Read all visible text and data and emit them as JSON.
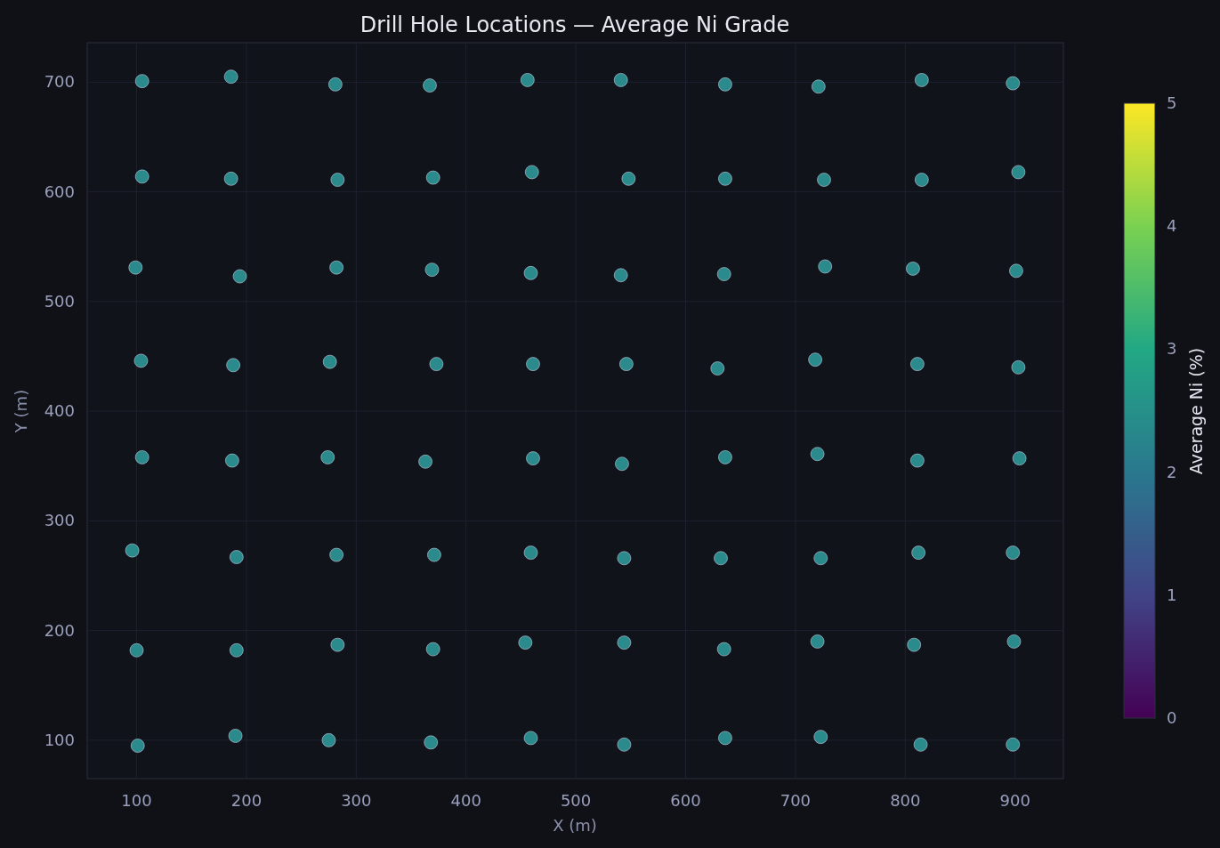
{
  "chart": {
    "chart_data": {
      "type": "scatter",
      "title": "Drill Hole Locations — Average Ni Grade",
      "xlabel": "X (m)",
      "ylabel": "Y (m)",
      "x": [
        105,
        186,
        281,
        367,
        456,
        541,
        636,
        721,
        815,
        898,
        105,
        186,
        283,
        370,
        460,
        548,
        636,
        726,
        815,
        903,
        99,
        194,
        282,
        369,
        459,
        541,
        635,
        727,
        807,
        901,
        104,
        188,
        276,
        373,
        461,
        546,
        629,
        718,
        811,
        903,
        105,
        187,
        274,
        363,
        461,
        542,
        636,
        720,
        811,
        904,
        96,
        191,
        282,
        371,
        459,
        544,
        632,
        723,
        812,
        898,
        100,
        191,
        283,
        370,
        454,
        544,
        635,
        720,
        808,
        899,
        101,
        190,
        275,
        368,
        459,
        544,
        636,
        723,
        814,
        898
      ],
      "grid": true,
      "series": [
        {
          "color": "#2a8a8c",
          "values": [
            701,
            705,
            698,
            697,
            702,
            702,
            698,
            696,
            702,
            699,
            614,
            612,
            611,
            613,
            618,
            612,
            612,
            611,
            611,
            618,
            531,
            523,
            531,
            529,
            526,
            524,
            525,
            532,
            530,
            528,
            446,
            442,
            445,
            443,
            443,
            443,
            439,
            447,
            443,
            440,
            358,
            355,
            358,
            354,
            357,
            352,
            358,
            361,
            355,
            357,
            273,
            267,
            269,
            269,
            271,
            266,
            266,
            266,
            271,
            271,
            182,
            182,
            187,
            183,
            189,
            189,
            183,
            190,
            187,
            190,
            95,
            104,
            100,
            98,
            102,
            96,
            102,
            103,
            96,
            96
          ]
        }
      ],
      "xlim": [
        55,
        944
      ],
      "ylim": [
        65,
        736
      ],
      "xticks": [
        100,
        200,
        300,
        400,
        500,
        600,
        700,
        800,
        900
      ],
      "yticks": [
        100,
        200,
        300,
        400,
        500,
        600,
        700
      ]
    },
    "colorbar": {
      "label": "Average Ni (%)",
      "ticks": [
        "5",
        "4",
        "3",
        "2",
        "1",
        "0"
      ]
    }
  }
}
